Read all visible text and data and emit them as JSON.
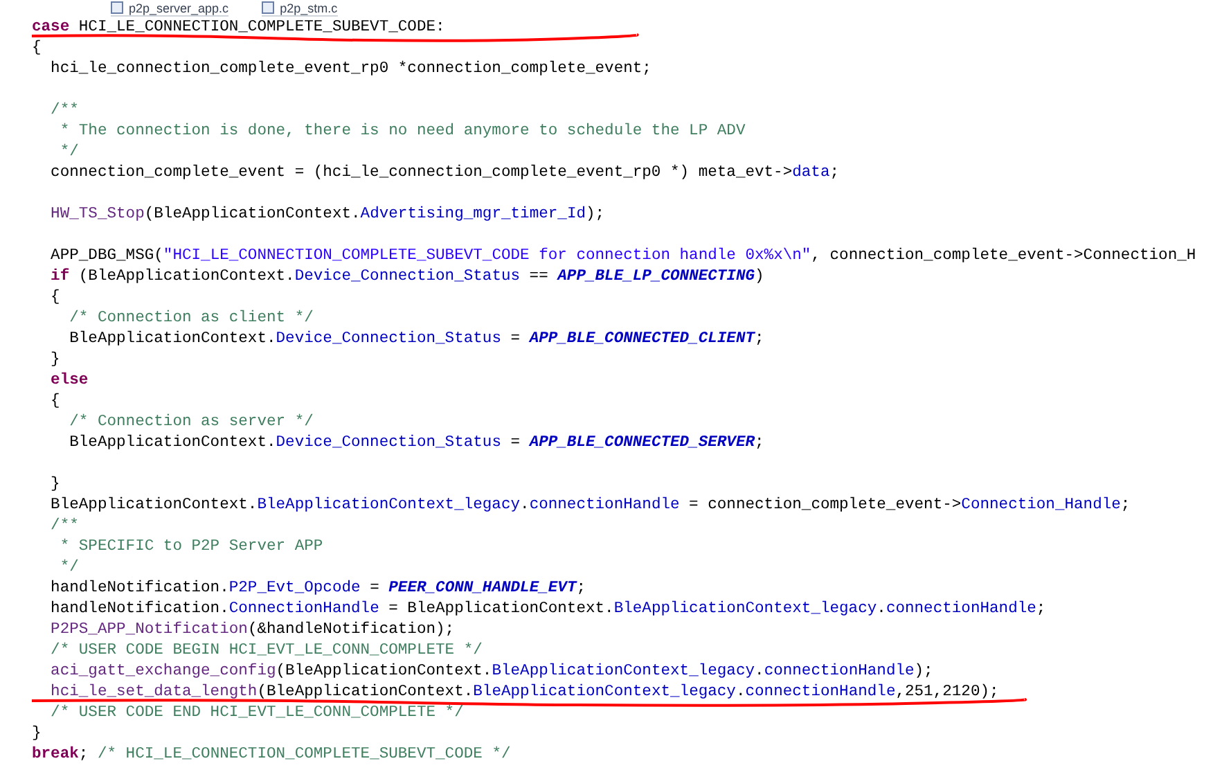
{
  "tabs": [
    {
      "label": "p2p_server_app.c"
    },
    {
      "label": "p2p_stm.c"
    }
  ],
  "lines": [
    {
      "kind": "code",
      "underlined": true,
      "spans": [
        {
          "text": "case",
          "kind": "keyword"
        },
        {
          "text": " HCI_LE_CONNECTION_COMPLETE_SUBEVT_CODE:",
          "kind": "plain"
        }
      ]
    },
    {
      "kind": "code",
      "underlined": false,
      "spans": [
        {
          "text": "{",
          "kind": "plain"
        }
      ]
    },
    {
      "kind": "code",
      "underlined": false,
      "spans": [
        {
          "text": "  hci_le_connection_complete_event_rp0 *connection_complete_event;",
          "kind": "plain"
        }
      ]
    },
    {
      "kind": "blank"
    },
    {
      "kind": "code",
      "underlined": false,
      "spans": [
        {
          "text": "  /**",
          "kind": "comment"
        }
      ]
    },
    {
      "kind": "code",
      "underlined": false,
      "spans": [
        {
          "text": "   * The connection is done, there is no need anymore to schedule the LP ADV",
          "kind": "comment"
        }
      ]
    },
    {
      "kind": "code",
      "underlined": false,
      "spans": [
        {
          "text": "   */",
          "kind": "comment"
        }
      ]
    },
    {
      "kind": "code",
      "underlined": false,
      "spans": [
        {
          "text": "  connection_complete_event = (hci_le_connection_complete_event_rp0 *) meta_evt->",
          "kind": "plain"
        },
        {
          "text": "data",
          "kind": "field"
        },
        {
          "text": ";",
          "kind": "plain"
        }
      ]
    },
    {
      "kind": "blank"
    },
    {
      "kind": "code",
      "underlined": false,
      "spans": [
        {
          "text": "  HW_TS_Stop",
          "kind": "function"
        },
        {
          "text": "(BleApplicationContext.",
          "kind": "plain"
        },
        {
          "text": "Advertising_mgr_timer_Id",
          "kind": "field"
        },
        {
          "text": ");",
          "kind": "plain"
        }
      ]
    },
    {
      "kind": "blank"
    },
    {
      "kind": "code",
      "underlined": false,
      "spans": [
        {
          "text": "  APP_DBG_MSG(",
          "kind": "plain"
        },
        {
          "text": "\"HCI_LE_CONNECTION_COMPLETE_SUBEVT_CODE for connection handle 0x%x\\n\"",
          "kind": "string"
        },
        {
          "text": ", connection_complete_event->Connection_H",
          "kind": "plain"
        }
      ]
    },
    {
      "kind": "code",
      "underlined": false,
      "spans": [
        {
          "text": "  if",
          "kind": "keyword"
        },
        {
          "text": " (BleApplicationContext.",
          "kind": "plain"
        },
        {
          "text": "Device_Connection_Status",
          "kind": "field"
        },
        {
          "text": " == ",
          "kind": "plain"
        },
        {
          "text": "APP_BLE_LP_CONNECTING",
          "kind": "constant"
        },
        {
          "text": ")",
          "kind": "plain"
        }
      ]
    },
    {
      "kind": "code",
      "underlined": false,
      "spans": [
        {
          "text": "  {",
          "kind": "plain"
        }
      ]
    },
    {
      "kind": "code",
      "underlined": false,
      "spans": [
        {
          "text": "    /* Connection as client */",
          "kind": "comment"
        }
      ]
    },
    {
      "kind": "code",
      "underlined": false,
      "spans": [
        {
          "text": "    BleApplicationContext.",
          "kind": "plain"
        },
        {
          "text": "Device_Connection_Status",
          "kind": "field"
        },
        {
          "text": " = ",
          "kind": "plain"
        },
        {
          "text": "APP_BLE_CONNECTED_CLIENT",
          "kind": "constant"
        },
        {
          "text": ";",
          "kind": "plain"
        }
      ]
    },
    {
      "kind": "code",
      "underlined": false,
      "spans": [
        {
          "text": "  }",
          "kind": "plain"
        }
      ]
    },
    {
      "kind": "code",
      "underlined": false,
      "spans": [
        {
          "text": "  else",
          "kind": "keyword"
        }
      ]
    },
    {
      "kind": "code",
      "underlined": false,
      "spans": [
        {
          "text": "  {",
          "kind": "plain"
        }
      ]
    },
    {
      "kind": "code",
      "underlined": false,
      "spans": [
        {
          "text": "    /* Connection as server */",
          "kind": "comment"
        }
      ]
    },
    {
      "kind": "code",
      "underlined": false,
      "spans": [
        {
          "text": "    BleApplicationContext.",
          "kind": "plain"
        },
        {
          "text": "Device_Connection_Status",
          "kind": "field"
        },
        {
          "text": " = ",
          "kind": "plain"
        },
        {
          "text": "APP_BLE_CONNECTED_SERVER",
          "kind": "constant"
        },
        {
          "text": ";",
          "kind": "plain"
        }
      ]
    },
    {
      "kind": "blank"
    },
    {
      "kind": "code",
      "underlined": false,
      "spans": [
        {
          "text": "  }",
          "kind": "plain"
        }
      ]
    },
    {
      "kind": "code",
      "underlined": false,
      "spans": [
        {
          "text": "  BleApplicationContext.",
          "kind": "plain"
        },
        {
          "text": "BleApplicationContext_legacy",
          "kind": "field"
        },
        {
          "text": ".",
          "kind": "plain"
        },
        {
          "text": "connectionHandle",
          "kind": "field"
        },
        {
          "text": " = connection_complete_event->",
          "kind": "plain"
        },
        {
          "text": "Connection_Handle",
          "kind": "field"
        },
        {
          "text": ";",
          "kind": "plain"
        }
      ]
    },
    {
      "kind": "code",
      "underlined": false,
      "spans": [
        {
          "text": "  /**",
          "kind": "comment"
        }
      ]
    },
    {
      "kind": "code",
      "underlined": false,
      "spans": [
        {
          "text": "   * SPECIFIC to P2P Server APP",
          "kind": "comment"
        }
      ]
    },
    {
      "kind": "code",
      "underlined": false,
      "spans": [
        {
          "text": "   */",
          "kind": "comment"
        }
      ]
    },
    {
      "kind": "code",
      "underlined": false,
      "spans": [
        {
          "text": "  handleNotification.",
          "kind": "plain"
        },
        {
          "text": "P2P_Evt_Opcode",
          "kind": "field"
        },
        {
          "text": " = ",
          "kind": "plain"
        },
        {
          "text": "PEER_CONN_HANDLE_EVT",
          "kind": "constant"
        },
        {
          "text": ";",
          "kind": "plain"
        }
      ]
    },
    {
      "kind": "code",
      "underlined": false,
      "spans": [
        {
          "text": "  handleNotification.",
          "kind": "plain"
        },
        {
          "text": "ConnectionHandle",
          "kind": "field"
        },
        {
          "text": " = BleApplicationContext.",
          "kind": "plain"
        },
        {
          "text": "BleApplicationContext_legacy",
          "kind": "field"
        },
        {
          "text": ".",
          "kind": "plain"
        },
        {
          "text": "connectionHandle",
          "kind": "field"
        },
        {
          "text": ";",
          "kind": "plain"
        }
      ]
    },
    {
      "kind": "code",
      "underlined": false,
      "spans": [
        {
          "text": "  P2PS_APP_Notification",
          "kind": "function"
        },
        {
          "text": "(&handleNotification);",
          "kind": "plain"
        }
      ]
    },
    {
      "kind": "code",
      "underlined": false,
      "spans": [
        {
          "text": "  /* USER CODE BEGIN HCI_EVT_LE_CONN_COMPLETE */",
          "kind": "comment"
        }
      ]
    },
    {
      "kind": "code",
      "underlined": false,
      "spans": [
        {
          "text": "  aci_gatt_exchange_config",
          "kind": "function"
        },
        {
          "text": "(BleApplicationContext.",
          "kind": "plain"
        },
        {
          "text": "BleApplicationContext_legacy",
          "kind": "field"
        },
        {
          "text": ".",
          "kind": "plain"
        },
        {
          "text": "connectionHandle",
          "kind": "field"
        },
        {
          "text": ");",
          "kind": "plain"
        }
      ]
    },
    {
      "kind": "code",
      "underlined": true,
      "spans": [
        {
          "text": "  hci_le_set_data_length",
          "kind": "function"
        },
        {
          "text": "(BleApplicationContext.",
          "kind": "plain"
        },
        {
          "text": "BleApplicationContext_legacy",
          "kind": "field"
        },
        {
          "text": ".",
          "kind": "plain"
        },
        {
          "text": "connectionHandle",
          "kind": "field"
        },
        {
          "text": ",251,2120);",
          "kind": "plain"
        }
      ]
    },
    {
      "kind": "code",
      "underlined": false,
      "spans": [
        {
          "text": "  /* USER CODE END HCI_EVT_LE_CONN_COMPLETE */",
          "kind": "comment"
        }
      ]
    },
    {
      "kind": "code",
      "underlined": false,
      "spans": [
        {
          "text": "}",
          "kind": "plain"
        }
      ]
    },
    {
      "kind": "code",
      "underlined": false,
      "spans": [
        {
          "text": "break",
          "kind": "keyword"
        },
        {
          "text": "; ",
          "kind": "plain"
        },
        {
          "text": "/* HCI_LE_CONNECTION_COMPLETE_SUBEVT_CODE */",
          "kind": "comment"
        }
      ]
    }
  ]
}
